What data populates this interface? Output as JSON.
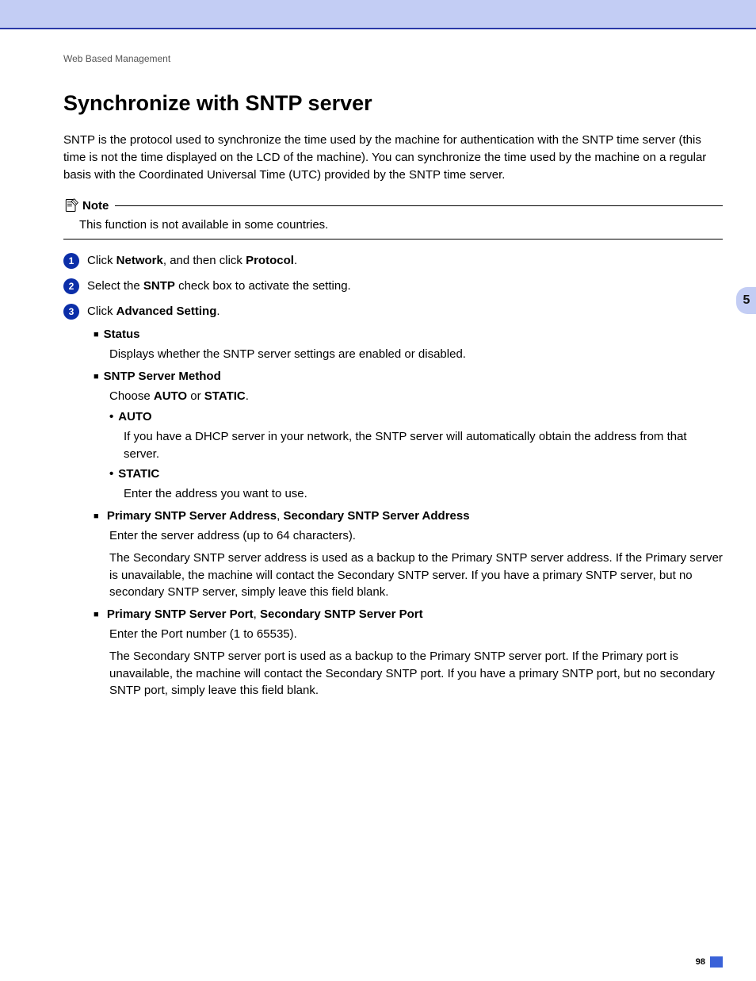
{
  "header": {
    "section": "Web Based Management"
  },
  "title": "Synchronize with SNTP server",
  "intro": "SNTP is the protocol used to synchronize the time used by the machine for authentication with the SNTP time server (this time is not the time displayed on the LCD of the machine). You can synchronize the time used by the machine on a regular basis with the Coordinated Universal Time (UTC) provided by the SNTP time server.",
  "note": {
    "label": "Note",
    "body": "This function is not available in some countries."
  },
  "steps": {
    "s1": {
      "num": "1",
      "pre": "Click ",
      "b1": "Network",
      "mid": ", and then click ",
      "b2": "Protocol",
      "post": "."
    },
    "s2": {
      "num": "2",
      "pre": "Select the ",
      "b1": "SNTP",
      "post": " check box to activate the setting."
    },
    "s3": {
      "num": "3",
      "pre": " Click ",
      "b1": "Advanced Setting",
      "post": "."
    }
  },
  "enum": {
    "status": {
      "heading": "Status",
      "body": "Displays whether the SNTP server settings are enabled or disabled."
    },
    "method": {
      "heading": "SNTP Server Method",
      "body_pre": "Choose ",
      "auto": "AUTO",
      "or": " or ",
      "static": "STATIC",
      "body_post": ".",
      "opt_auto": {
        "heading": "AUTO",
        "body": "If you have a DHCP server in your network, the SNTP server will automatically obtain the address from that server."
      },
      "opt_static": {
        "heading": "STATIC",
        "body": "Enter the address you want to use."
      }
    },
    "address": {
      "heading_a": "Primary SNTP Server Address",
      "sep": ", ",
      "heading_b": "Secondary SNTP Server Address",
      "body1": "Enter the server address (up to 64 characters).",
      "body2": "The Secondary SNTP server address is used as a backup to the Primary SNTP server address. If the Primary server is unavailable, the machine will contact the Secondary SNTP server. If you have a primary SNTP server, but no secondary SNTP server, simply leave this field blank."
    },
    "port": {
      "heading_a": "Primary SNTP Server Port",
      "sep": ", ",
      "heading_b": "Secondary SNTP Server Port",
      "body1": "Enter the Port number (1 to 65535).",
      "body2": "The Secondary SNTP server port is used as a backup to the Primary SNTP server port. If the Primary port is unavailable, the machine will contact the Secondary SNTP port. If you have a primary SNTP port, but no secondary SNTP port, simply leave this field blank."
    }
  },
  "sidetab": {
    "chapter": "5"
  },
  "footer": {
    "page": "98"
  }
}
